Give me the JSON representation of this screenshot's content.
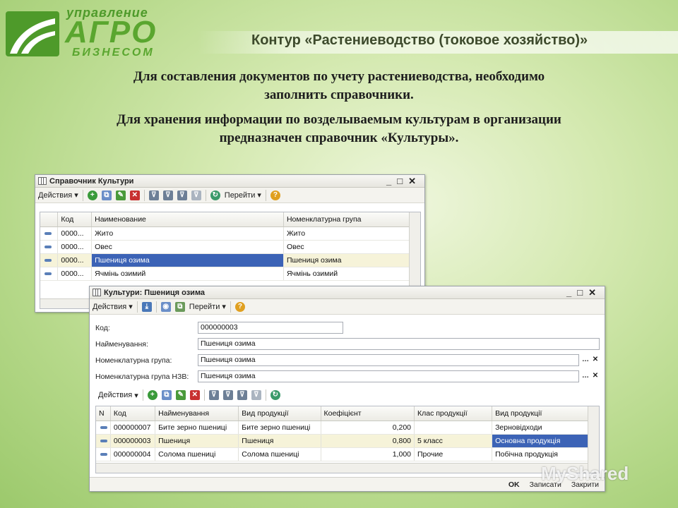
{
  "logo": {
    "top": "управление",
    "mid": "АГРО",
    "bottom": "БИЗНЕСОМ"
  },
  "header": {
    "title": "Контур «Растениеводство (токовое хозяйство)»"
  },
  "paragraphs": {
    "p1_line1": "Для составления документов по учету растениеводства, необходимо",
    "p1_line2": "заполнить справочники.",
    "p2_line1": "Для хранения информации по возделываемым культурам в организации",
    "p2_line2": "предназначен справочник «Культуры»."
  },
  "win1": {
    "title": "Справочник Культури",
    "toolbar": {
      "actions": "Действия",
      "goto": "Перейти"
    },
    "columns": [
      "Код",
      "Наименование",
      "Номенклатурна група"
    ],
    "rows": [
      {
        "code": "0000...",
        "name": "Жито",
        "group": "Жито"
      },
      {
        "code": "0000...",
        "name": "Овес",
        "group": "Овес"
      },
      {
        "code": "0000...",
        "name": "Пшениця озима",
        "group": "Пшениця озима"
      },
      {
        "code": "0000...",
        "name": "Ячмінь озимий",
        "group": "Ячмінь озимий"
      }
    ]
  },
  "win2": {
    "title": "Культури: Пшениця озима",
    "toolbar": {
      "actions": "Действия",
      "goto": "Перейти"
    },
    "fields": {
      "code_label": "Код:",
      "code_value": "000000003",
      "name_label": "Найменування:",
      "name_value": "Пшениця озима",
      "group_label": "Номенклатурна група:",
      "group_value": "Пшениця озима",
      "nzv_label": "Номенклатурна група НЗВ:",
      "nzv_value": "Пшениця озима"
    },
    "subtoolbar": {
      "actions": "Действия"
    },
    "columns": [
      "N",
      "Код",
      "Найменування",
      "Вид продукції",
      "Коефіцієнт",
      "Клас продукції",
      "Вид продукції"
    ],
    "rows": [
      {
        "code": "000000007",
        "name": "Бите зерно пшениці",
        "kind": "Бите зерно пшениці",
        "coef": "0,200",
        "cls": "",
        "type": "Зерновідходи"
      },
      {
        "code": "000000003",
        "name": "Пшениця",
        "kind": "Пшениця",
        "coef": "0,800",
        "cls": "5 класс",
        "type": "Основна продукція"
      },
      {
        "code": "000000004",
        "name": "Солома пшениці",
        "kind": "Солома пшениці",
        "coef": "1,000",
        "cls": "Прочие",
        "type": "Побічна продукція"
      }
    ],
    "bottom": {
      "ok": "OK",
      "save": "Записати",
      "close": "Закрити"
    }
  },
  "watermark": "MyShared",
  "colors": {
    "accent_green": "#5aa62f",
    "selection_blue": "#3c63b6"
  }
}
